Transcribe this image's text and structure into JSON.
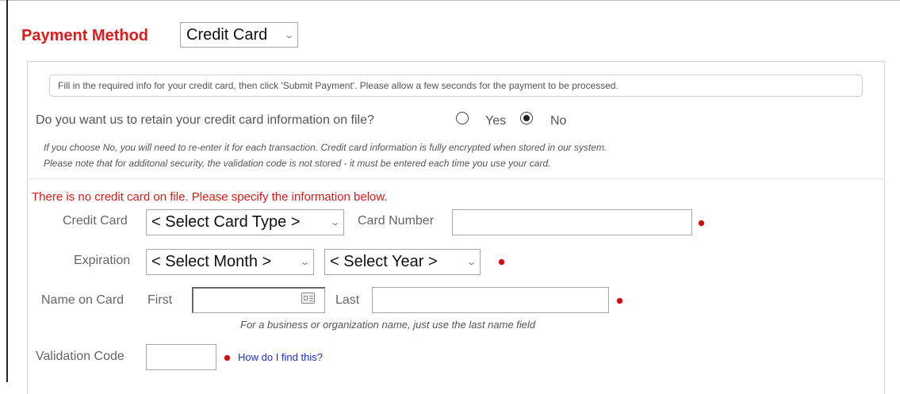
{
  "payment_method": {
    "label": "Payment Method",
    "selected": "Credit Card"
  },
  "info_box": {
    "text": "Fill in the required info for your credit card, then click 'Submit Payment'. Please allow a few seconds for the payment to be processed."
  },
  "retain": {
    "question": "Do you want us to retain your credit card information on file?",
    "options": [
      {
        "label": "Yes",
        "checked": false
      },
      {
        "label": "No",
        "checked": true
      }
    ],
    "note_line1": "If you choose No, you will need to re-enter it for each transaction. Credit card information is fully encrypted when stored in our system.",
    "note_line2": "Please note that for additonal security, the validation code is not stored - it must be entered each time you use your card."
  },
  "warning": "There is no credit card on file. Please specify the information below.",
  "form": {
    "credit_card_label": "Credit Card",
    "card_type_selected": "< Select Card Type >",
    "card_number_label": "Card Number",
    "card_number_value": "",
    "expiration_label": "Expiration",
    "month_selected": "< Select Month >",
    "year_selected": "< Select Year >",
    "name_label": "Name on Card",
    "first_label": "First",
    "first_value": "",
    "last_label": "Last",
    "last_value": "",
    "business_note": "For a business or organization name, just use the last name field",
    "validation_label": "Validation Code",
    "validation_value": "",
    "help_link": "How do I find this?"
  },
  "colors": {
    "accent_red": "#e01a1a",
    "link_blue": "#1a2fd8",
    "required_dot": "#d10f0f"
  },
  "icons": {
    "select_arrow": "chevron-down-icon",
    "autofill": "contact-card-icon",
    "required": "required-dot-icon"
  }
}
